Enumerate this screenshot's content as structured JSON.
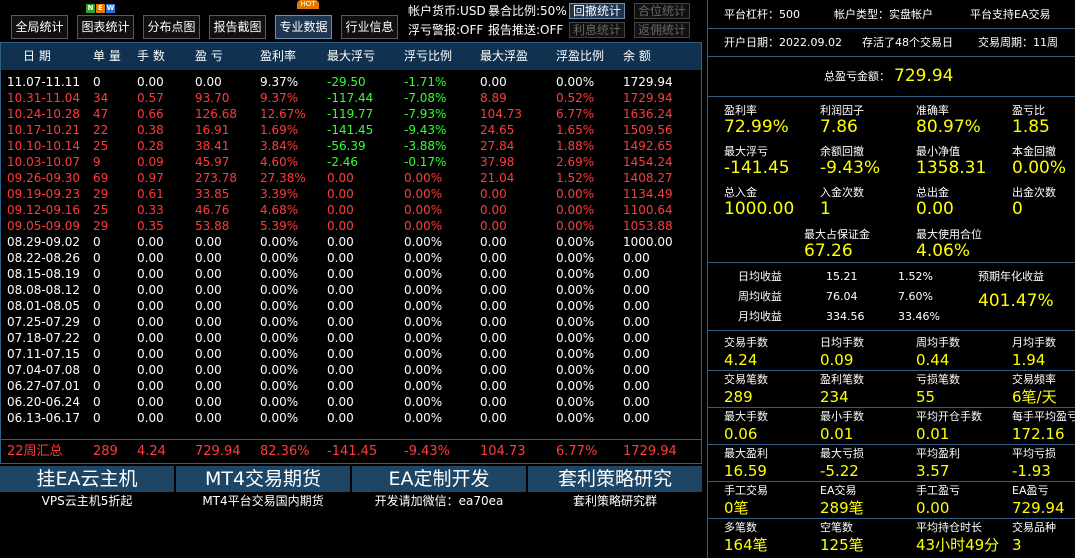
{
  "toolbar": {
    "buttons": [
      "全局统计",
      "图表统计",
      "分布点图",
      "报告截图",
      "专业数据",
      "行业信息"
    ],
    "new_badge": [
      "N",
      "E",
      "W"
    ],
    "hot_badge": "HOT",
    "currency": "帐户货币:USD",
    "ratio": "暴合比例:50%",
    "float_ctrl": "浮亏警报:OFF",
    "report_push": "报告推送:OFF",
    "small_buttons": [
      "回撤统计",
      "合位统计",
      "利息统计",
      "返佣统计"
    ]
  },
  "colors": {
    "red": "#ff3b3b",
    "green": "#33ff33",
    "white": "#ffffff",
    "yellow": "#ffff00",
    "header_bg": "#10314f",
    "ad_bg": "#1c4566"
  },
  "table": {
    "headers": [
      "日 期",
      "单 量",
      "手 数",
      "盈 亏",
      "盈利率",
      "最大浮亏",
      "浮亏比例",
      "最大浮盈",
      "浮盈比例",
      "余 额"
    ],
    "rows": [
      {
        "c": "w",
        "v": [
          "11.07-11.11",
          "0",
          "0.00",
          "0.00",
          "9.37%",
          "-29.50",
          "-1.71%",
          "0.00",
          "0.00%",
          "1729.94"
        ]
      },
      {
        "c": "r",
        "v": [
          "10.31-11.04",
          "34",
          "0.57",
          "93.70",
          "9.37%",
          "-117.44",
          "-7.08%",
          "8.89",
          "0.52%",
          "1729.94"
        ]
      },
      {
        "c": "r",
        "v": [
          "10.24-10.28",
          "47",
          "0.66",
          "126.68",
          "12.67%",
          "-119.77",
          "-7.93%",
          "104.73",
          "6.77%",
          "1636.24"
        ]
      },
      {
        "c": "r",
        "v": [
          "10.17-10.21",
          "22",
          "0.38",
          "16.91",
          "1.69%",
          "-141.45",
          "-9.43%",
          "24.65",
          "1.65%",
          "1509.56"
        ]
      },
      {
        "c": "r",
        "v": [
          "10.10-10.14",
          "25",
          "0.28",
          "38.41",
          "3.84%",
          "-56.39",
          "-3.88%",
          "27.84",
          "1.88%",
          "1492.65"
        ]
      },
      {
        "c": "r",
        "v": [
          "10.03-10.07",
          "9",
          "0.09",
          "45.97",
          "4.60%",
          "-2.46",
          "-0.17%",
          "37.98",
          "2.69%",
          "1454.24"
        ]
      },
      {
        "c": "r",
        "v": [
          "09.26-09.30",
          "69",
          "0.97",
          "273.78",
          "27.38%",
          "0.00",
          "0.00%",
          "21.04",
          "1.52%",
          "1408.27"
        ]
      },
      {
        "c": "r",
        "v": [
          "09.19-09.23",
          "29",
          "0.61",
          "33.85",
          "3.39%",
          "0.00",
          "0.00%",
          "0.00",
          "0.00%",
          "1134.49"
        ]
      },
      {
        "c": "r",
        "v": [
          "09.12-09.16",
          "25",
          "0.33",
          "46.76",
          "4.68%",
          "0.00",
          "0.00%",
          "0.00",
          "0.00%",
          "1100.64"
        ]
      },
      {
        "c": "r",
        "v": [
          "09.05-09.09",
          "29",
          "0.35",
          "53.88",
          "5.39%",
          "0.00",
          "0.00%",
          "0.00",
          "0.00%",
          "1053.88"
        ]
      },
      {
        "c": "w",
        "v": [
          "08.29-09.02",
          "0",
          "0.00",
          "0.00",
          "0.00%",
          "0.00",
          "0.00%",
          "0.00",
          "0.00%",
          "1000.00"
        ]
      },
      {
        "c": "w",
        "v": [
          "08.22-08.26",
          "0",
          "0.00",
          "0.00",
          "0.00%",
          "0.00",
          "0.00%",
          "0.00",
          "0.00%",
          "0.00"
        ]
      },
      {
        "c": "w",
        "v": [
          "08.15-08.19",
          "0",
          "0.00",
          "0.00",
          "0.00%",
          "0.00",
          "0.00%",
          "0.00",
          "0.00%",
          "0.00"
        ]
      },
      {
        "c": "w",
        "v": [
          "08.08-08.12",
          "0",
          "0.00",
          "0.00",
          "0.00%",
          "0.00",
          "0.00%",
          "0.00",
          "0.00%",
          "0.00"
        ]
      },
      {
        "c": "w",
        "v": [
          "08.01-08.05",
          "0",
          "0.00",
          "0.00",
          "0.00%",
          "0.00",
          "0.00%",
          "0.00",
          "0.00%",
          "0.00"
        ]
      },
      {
        "c": "w",
        "v": [
          "07.25-07.29",
          "0",
          "0.00",
          "0.00",
          "0.00%",
          "0.00",
          "0.00%",
          "0.00",
          "0.00%",
          "0.00"
        ]
      },
      {
        "c": "w",
        "v": [
          "07.18-07.22",
          "0",
          "0.00",
          "0.00",
          "0.00%",
          "0.00",
          "0.00%",
          "0.00",
          "0.00%",
          "0.00"
        ]
      },
      {
        "c": "w",
        "v": [
          "07.11-07.15",
          "0",
          "0.00",
          "0.00",
          "0.00%",
          "0.00",
          "0.00%",
          "0.00",
          "0.00%",
          "0.00"
        ]
      },
      {
        "c": "w",
        "v": [
          "07.04-07.08",
          "0",
          "0.00",
          "0.00",
          "0.00%",
          "0.00",
          "0.00%",
          "0.00",
          "0.00%",
          "0.00"
        ]
      },
      {
        "c": "w",
        "v": [
          "06.27-07.01",
          "0",
          "0.00",
          "0.00",
          "0.00%",
          "0.00",
          "0.00%",
          "0.00",
          "0.00%",
          "0.00"
        ]
      },
      {
        "c": "w",
        "v": [
          "06.20-06.24",
          "0",
          "0.00",
          "0.00",
          "0.00%",
          "0.00",
          "0.00%",
          "0.00",
          "0.00%",
          "0.00"
        ]
      },
      {
        "c": "w",
        "v": [
          "06.13-06.17",
          "0",
          "0.00",
          "0.00",
          "0.00%",
          "0.00",
          "0.00%",
          "0.00",
          "0.00%",
          "0.00"
        ]
      }
    ],
    "summary": [
      "22周汇总",
      "289",
      "4.24",
      "729.94",
      "82.36%",
      "-141.45",
      "-9.43%",
      "104.73",
      "6.77%",
      "1729.94"
    ]
  },
  "ads": [
    {
      "title": "挂EA云主机",
      "sub": "VPS云主机5折起"
    },
    {
      "title": "MT4交易期货",
      "sub": "MT4平台交易国内期货"
    },
    {
      "title": "EA定制开发",
      "sub": "开发请加微信：ea70ea"
    },
    {
      "title": "套利策略研究",
      "sub": "套利策略研究群"
    }
  ],
  "right": {
    "leverage": "平台杠杆：500",
    "acct_type": "帐户类型：实盘帐户",
    "platform": "平台支持EA交易",
    "open_date": "开户日期：2022.09.02",
    "survived": "存活了48个交易日",
    "period": "交易周期：11周",
    "total_label": "总盈亏金额：",
    "total_value": "729.94",
    "grid1": [
      {
        "label": "盈利率",
        "value": "72.99%"
      },
      {
        "label": "利润因子",
        "value": "7.86"
      },
      {
        "label": "准确率",
        "value": "80.97%"
      },
      {
        "label": "盈亏比",
        "value": "1.85"
      },
      {
        "label": "最大浮亏",
        "value": "-141.45"
      },
      {
        "label": "余额回撤",
        "value": "-9.43%"
      },
      {
        "label": "最小净值",
        "value": "1358.31"
      },
      {
        "label": "本金回撤",
        "value": "0.00%"
      },
      {
        "label": "总入金",
        "value": "1000.00"
      },
      {
        "label": "入金次数",
        "value": "1"
      },
      {
        "label": "总出金",
        "value": "0.00"
      },
      {
        "label": "出金次数",
        "value": "0"
      }
    ],
    "margin": [
      {
        "label": "最大占保证金",
        "value": "67.26"
      },
      {
        "label": "最大使用合位",
        "value": "4.06%"
      }
    ],
    "returns": [
      {
        "label": "日均收益",
        "amount": "15.21",
        "pct": "1.52%"
      },
      {
        "label": "周均收益",
        "amount": "76.04",
        "pct": "7.60%"
      },
      {
        "label": "月均收益",
        "amount": "334.56",
        "pct": "33.46%"
      }
    ],
    "annual_label": "预期年化收益",
    "annual_value": "401.47%",
    "grid2": [
      {
        "label": "交易手数",
        "value": "4.24"
      },
      {
        "label": "日均手数",
        "value": "0.09"
      },
      {
        "label": "周均手数",
        "value": "0.44"
      },
      {
        "label": "月均手数",
        "value": "1.94"
      },
      {
        "label": "交易笔数",
        "value": "289"
      },
      {
        "label": "盈利笔数",
        "value": "234"
      },
      {
        "label": "亏损笔数",
        "value": "55"
      },
      {
        "label": "交易频率",
        "value": "6笔/天"
      },
      {
        "label": "最大手数",
        "value": "0.06"
      },
      {
        "label": "最小手数",
        "value": "0.01"
      },
      {
        "label": "平均开仓手数",
        "value": "0.01"
      },
      {
        "label": "每手平均盈亏",
        "value": "172.16"
      },
      {
        "label": "最大盈利",
        "value": "16.59"
      },
      {
        "label": "最大亏损",
        "value": "-5.22"
      },
      {
        "label": "平均盈利",
        "value": "3.57"
      },
      {
        "label": "平均亏损",
        "value": "-1.93"
      },
      {
        "label": "手工交易",
        "value": "0笔"
      },
      {
        "label": "EA交易",
        "value": "289笔"
      },
      {
        "label": "手工盈亏",
        "value": "0.00"
      },
      {
        "label": "EA盈亏",
        "value": "729.94"
      },
      {
        "label": "多笔数",
        "value": "164笔"
      },
      {
        "label": "空笔数",
        "value": "125笔"
      },
      {
        "label": "平均持仓时长",
        "value": "43小时49分"
      },
      {
        "label": "交易品种",
        "value": "3"
      }
    ]
  }
}
